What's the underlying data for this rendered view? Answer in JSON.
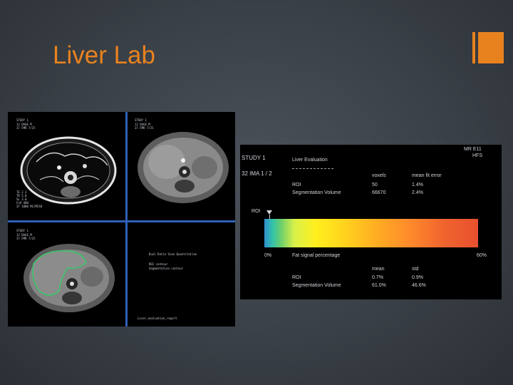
{
  "slide": {
    "title": "Liver Lab",
    "accent_color": "#e8821e"
  },
  "viewer": {
    "top_left": {
      "study": "STUDY 1",
      "lines": [
        "12 DAGE M",
        "37 FMR 7/25"
      ],
      "bottom_lines": [
        "TE 2.3",
        "TR 5.0",
        "SL 3.0",
        "FoV 400",
        "2F 1000 M1/MCX0"
      ]
    },
    "top_right": {
      "study": "STUDY 1",
      "lines": [
        "12 DAGE M",
        "37 FMR 7/25"
      ]
    },
    "bottom_left": {
      "study": "STUDY 1",
      "lines": [
        "12 DAGE M",
        "37 FMR 7/25"
      ]
    },
    "bottom_right": {
      "lines": [
        "Dual Ratio Scan Quantitation",
        "",
        "ROI contour",
        "Segmentation contour"
      ],
      "footer": "Liver_evaluation_report"
    },
    "roi_color": "#38c96a",
    "divider_color": "#2f5fb8"
  },
  "panel": {
    "orientation_top": "MR E11",
    "orientation_side": "HFS",
    "study_label": "STUDY 1",
    "image_label": "32 IMA 1 / 2",
    "section_title": "Liver Evaluation",
    "table1": {
      "headers": [
        "voxels",
        "mean fit error"
      ],
      "rows": [
        {
          "label": "ROI",
          "values": [
            "50",
            "1.4%"
          ]
        },
        {
          "label": "Segmentation Volume",
          "values": [
            "66670",
            "2.4%"
          ]
        }
      ]
    },
    "roi_label": "ROI",
    "scale_min": "0%",
    "scale_max": "60%",
    "scale_title": "Fat signal percentage",
    "scale_roi_fraction": 0.012,
    "table2": {
      "headers": [
        "mean",
        "std"
      ],
      "rows": [
        {
          "label": "ROI",
          "values": [
            "0.7%",
            "0.9%"
          ]
        },
        {
          "label": "Segmentation Volume",
          "values": [
            "61.0%",
            "46.6%"
          ]
        }
      ]
    }
  }
}
